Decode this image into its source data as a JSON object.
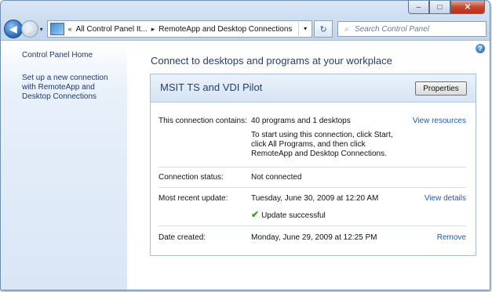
{
  "window": {
    "controls": {
      "minimize": "–",
      "maximize": "□",
      "close": "✕"
    }
  },
  "nav": {
    "back": "◀",
    "forward": "▶",
    "dropdown": "▾",
    "address_chevron": "«",
    "breadcrumbs": [
      "All Control Panel It...",
      "RemoteApp and Desktop Connections"
    ],
    "crumb_separator": "▸",
    "address_dropdown": "▾",
    "refresh": "↻",
    "search_placeholder": "Search Control Panel",
    "search_glyph": "⌕"
  },
  "sidebar": {
    "items": [
      {
        "label": "Control Panel Home"
      },
      {
        "label": "Set up a new connection with RemoteApp and Desktop Connections"
      }
    ]
  },
  "main": {
    "help": "?",
    "title": "Connect to desktops and programs at your workplace",
    "panel": {
      "title": "MSIT TS and VDI Pilot",
      "properties_label": "Properties",
      "rows": {
        "contains": {
          "label": "This connection contains:",
          "value": "40 programs and 1 desktops",
          "note": "To start using this connection, click Start, click All Programs, and then click RemoteApp and Desktop Connections.",
          "link": "View resources"
        },
        "status": {
          "label": "Connection status:",
          "value": "Not connected"
        },
        "update": {
          "label": "Most recent update:",
          "value": "Tuesday, June 30, 2009 at 12:20 AM",
          "result": "Update successful",
          "result_glyph": "✔",
          "link": "View details"
        },
        "created": {
          "label": "Date created:",
          "value": "Monday, June 29, 2009 at 12:25 PM",
          "link": "Remove"
        }
      }
    }
  },
  "colors": {
    "link": "#1e5bb5",
    "heading": "#1e3f73",
    "success": "#3aa01c",
    "close_button": "#c6452c"
  }
}
